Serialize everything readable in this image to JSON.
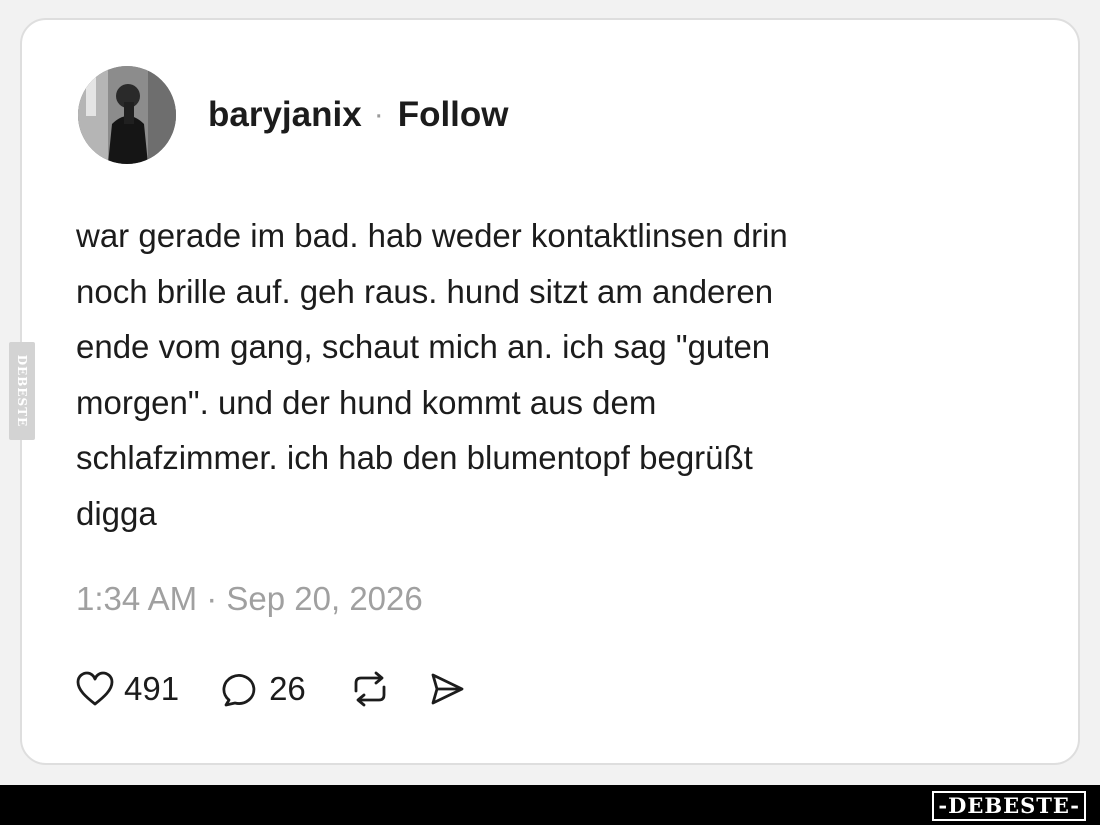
{
  "post": {
    "author": {
      "username": "baryjanix",
      "avatar_icon": "profile-photo"
    },
    "separator": "·",
    "follow_label": "Follow",
    "text": "war gerade im bad. hab weder kontaktlinsen drin\nnoch brille auf. geh raus. hund sitzt am anderen\nende vom gang, schaut mich an. ich sag \"guten\nmorgen\". und der hund kommt aus dem\nschlafzimmer. ich hab den blumentopf begrüßt\ndigga",
    "timestamp": "1:34 AM · Sep 20, 2026",
    "actions": {
      "like": {
        "icon": "heart-icon",
        "count": "491"
      },
      "reply": {
        "icon": "speech-bubble-icon",
        "count": "26"
      },
      "repost": {
        "icon": "repost-icon"
      },
      "share": {
        "icon": "send-icon"
      }
    }
  },
  "watermark": {
    "side_text": "DEBESTE",
    "brand_text": "-DEBESTE-"
  },
  "colors": {
    "text": "#1c1c1c",
    "muted": "#a0a0a0",
    "card_background": "#ffffff",
    "card_border": "#dedede",
    "page_background": "#f2f2f2",
    "footer_bar": "#000000"
  }
}
